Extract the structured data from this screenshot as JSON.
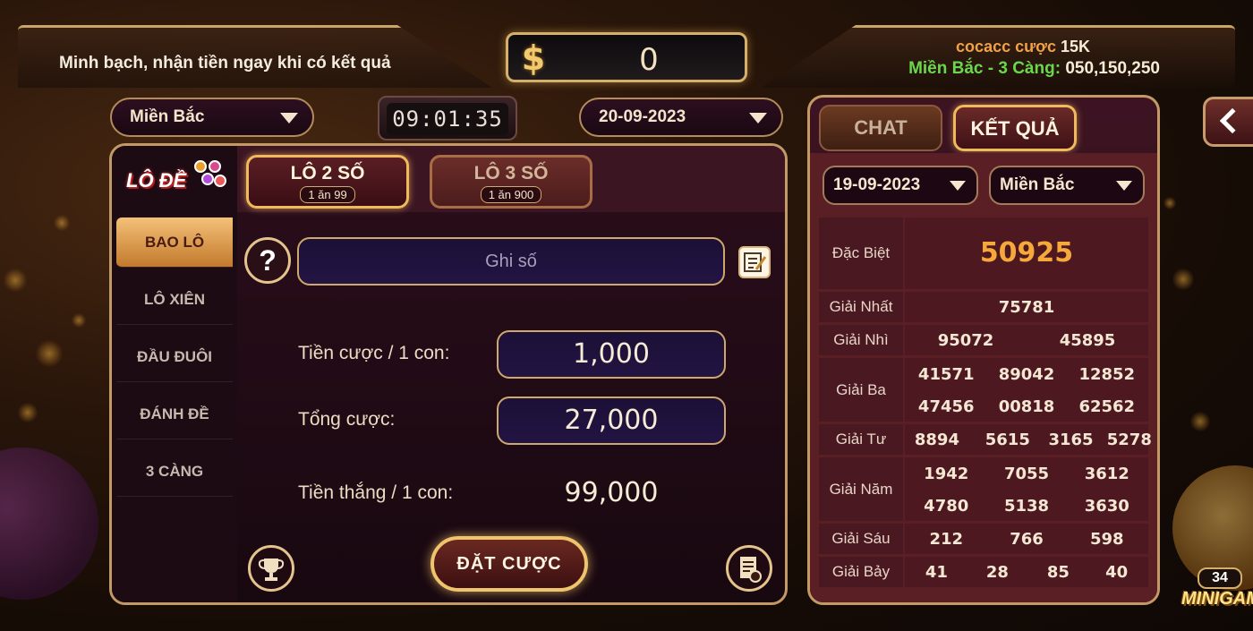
{
  "header": {
    "slogan": "Minh bạch, nhận tiền ngay khi có kết quả",
    "balance": "0",
    "ticker_user": "cocacc cược",
    "ticker_amount": "15K",
    "ticker_label": "Miền Bắc - 3 Càng:",
    "ticker_numbers": "050,150,250"
  },
  "controls": {
    "region": "Miền Bắc",
    "timer": "09:01:35",
    "date": "20-09-2023"
  },
  "sidebar": {
    "logo_text": "LÔ ĐỀ",
    "items": [
      {
        "label": "BAO LÔ"
      },
      {
        "label": "LÔ XIÊN"
      },
      {
        "label": "ĐẦU ĐUÔI"
      },
      {
        "label": "ĐÁNH ĐỀ"
      },
      {
        "label": "3 CÀNG"
      }
    ]
  },
  "game_tabs": [
    {
      "name": "LÔ 2 SỐ",
      "odds": "1 ăn 99"
    },
    {
      "name": "LÔ 3 SỐ",
      "odds": "1 ăn 900"
    }
  ],
  "bet_form": {
    "number_placeholder": "Ghi số",
    "stake_label": "Tiền cược / 1 con:",
    "stake_value": "1,000",
    "total_label": "Tổng cược:",
    "total_value": "27,000",
    "win_label": "Tiền thắng / 1 con:",
    "win_value": "99,000",
    "submit_label": "ĐẶT CƯỢC"
  },
  "results": {
    "tab_chat": "CHAT",
    "tab_result": "KẾT QUẢ",
    "date": "19-09-2023",
    "region": "Miền Bắc",
    "prizes": {
      "special_label": "Đặc Biệt",
      "special": "50925",
      "first_label": "Giải Nhất",
      "first": "75781",
      "second_label": "Giải Nhì",
      "second": [
        "95072",
        "45895"
      ],
      "third_label": "Giải Ba",
      "third": [
        "41571",
        "89042",
        "12852",
        "47456",
        "00818",
        "62562"
      ],
      "fourth_label": "Giải Tư",
      "fourth": [
        "8894",
        "5615",
        "3165",
        "5278"
      ],
      "fifth_label": "Giải Năm",
      "fifth": [
        "1942",
        "7055",
        "3612",
        "4780",
        "5138",
        "3630"
      ],
      "sixth_label": "Giải Sáu",
      "sixth": [
        "212",
        "766",
        "598"
      ],
      "seventh_label": "Giải Bảy",
      "seventh": [
        "41",
        "28",
        "85",
        "40"
      ]
    }
  },
  "minigame": {
    "count": "34",
    "label": "MINIGAM"
  },
  "colors": {
    "accent_gold": "#d4b06a",
    "special_prize": "#f7a83a",
    "ticker_green": "#6bd84b",
    "ticker_orange": "#f0a14a"
  }
}
